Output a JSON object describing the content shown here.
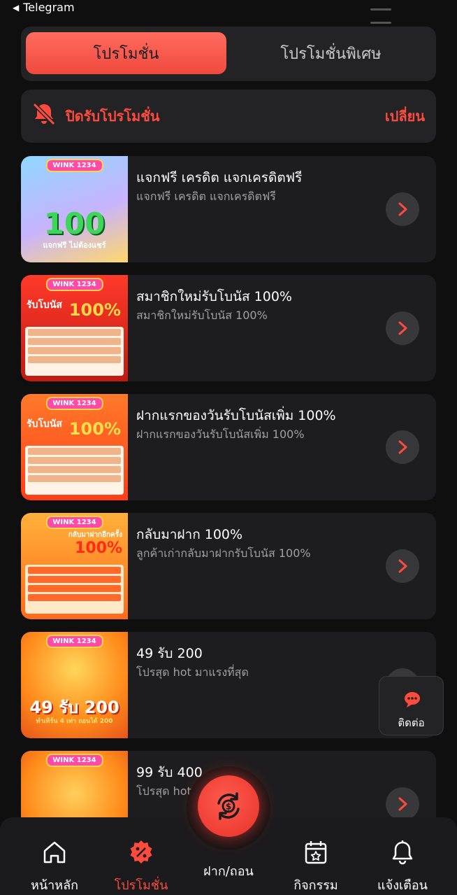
{
  "status": {
    "back_label": "Telegram"
  },
  "tabs": [
    {
      "label": "โปรโมชั่น",
      "active": true
    },
    {
      "label": "โปรโมชั่นพิเศษ",
      "active": false
    }
  ],
  "notify": {
    "label": "ปิดรับโปรโมชั่น",
    "action": "เปลี่ยน"
  },
  "promos": [
    {
      "title": "แจกฟรี เครดิต แจกเครดิตฟรี",
      "subtitle": "แจกฟรี เครดิต แจกเครดิตฟรี",
      "thumb_text": "100",
      "thumb_caption": "แจกฟรี ไม่ต้องแชร์"
    },
    {
      "title": "สมาชิกใหม่รับโบนัส 100%",
      "subtitle": "สมาชิกใหม่รับโบนัส 100%",
      "thumb_text": "100%",
      "thumb_caption": "รับโบนัส"
    },
    {
      "title": "ฝากแรกของวันรับโบนัสเพิ่ม 100%",
      "subtitle": "ฝากแรกของวันรับโบนัสเพิ่ม 100%",
      "thumb_text": "100%",
      "thumb_caption": "รับโบนัส"
    },
    {
      "title": "กลับมาฝาก 100%",
      "subtitle": "ลูกค้าเก่ากลับมาฝากรับโบนัส 100%",
      "thumb_text": "100%",
      "thumb_caption": "กลับมาฝากอีกครั้ง"
    },
    {
      "title": "49 รับ 200",
      "subtitle": "โปรสุด hot มาแรงที่สุด",
      "thumb_text": "49 รับ 200",
      "thumb_caption": "ทำเทิร์น 4 เท่า ถอนได้ 200"
    },
    {
      "title": "99 รับ 400",
      "subtitle": "โปรสุด hot มาแรงที่สุด",
      "thumb_text": "",
      "thumb_caption": ""
    }
  ],
  "thumb_logo": "WINK 1234",
  "contact": {
    "label": "ติดต่อ"
  },
  "nav": [
    {
      "label": "หน้าหลัก",
      "icon": "home-icon",
      "active": false
    },
    {
      "label": "โปรโมชั่น",
      "icon": "promotion-badge-icon",
      "active": true
    },
    {
      "label": "ฝาก/ถอน",
      "icon": "deposit-withdraw-icon",
      "active": false
    },
    {
      "label": "กิจกรรม",
      "icon": "calendar-star-icon",
      "active": false
    },
    {
      "label": "แจ้งเตือน",
      "icon": "bell-icon",
      "active": false
    }
  ],
  "colors": {
    "accent": "#ff4a3e",
    "card": "#1d1d1f",
    "panel": "#232325",
    "background": "#0f0f10"
  }
}
